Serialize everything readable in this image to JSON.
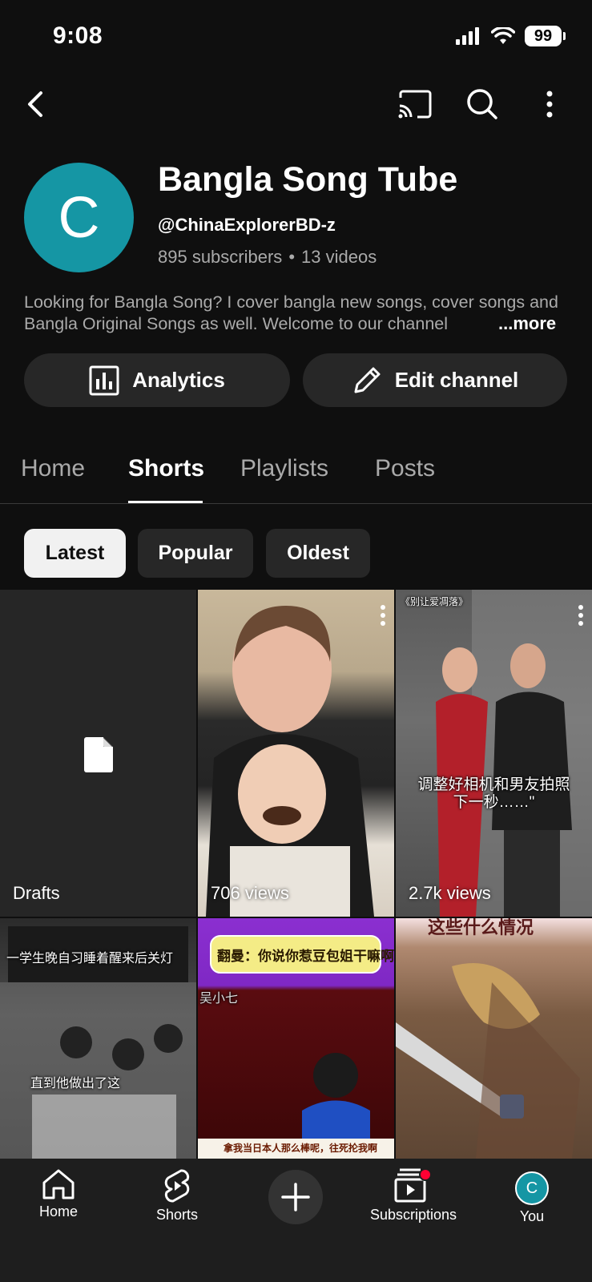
{
  "status_bar": {
    "time": "9:08",
    "battery": "99"
  },
  "channel": {
    "avatar_letter": "C",
    "name": "Bangla Song Tube",
    "handle": "@ChinaExplorerBD-z",
    "subscribers": "895 subscribers",
    "separator": "•",
    "videos": "13 videos",
    "description": "Looking for Bangla Song? I cover bangla new songs, cover songs and Bangla Original Songs as well. Welcome to our channel",
    "more_label": "...more"
  },
  "actions": {
    "analytics_label": "Analytics",
    "edit_label": "Edit channel"
  },
  "tabs": [
    {
      "label": "Home"
    },
    {
      "label": "Shorts"
    },
    {
      "label": "Playlists"
    },
    {
      "label": "Posts"
    }
  ],
  "chips": [
    {
      "label": "Latest"
    },
    {
      "label": "Popular"
    },
    {
      "label": "Oldest"
    }
  ],
  "grid": {
    "drafts_label": "Drafts",
    "items": [
      {
        "views": "706 views"
      },
      {
        "views": "2.7k views",
        "caption_top": "《别让爱凋落》",
        "caption_line1": "调整好相机和男友拍照",
        "caption_line2": "下一秒……\""
      },
      {
        "caption_top": "一学生晚自习睡着醒来后关灯",
        "caption_bottom": "直到他做出了这"
      },
      {
        "caption_top": "翻曼：你说你惹豆包姐干嘛啊",
        "caption_side": "吴小七",
        "caption_bottom": "拿我当日本人那么棒呢，往死抡我啊"
      },
      {
        "caption_top": "这些什么情况"
      }
    ]
  },
  "bottom_nav": [
    {
      "label": "Home"
    },
    {
      "label": "Shorts"
    },
    {
      "label": "Subscriptions"
    },
    {
      "label": "You",
      "avatar_letter": "C"
    }
  ],
  "colors": {
    "background": "#0f0f0f",
    "avatar": "#1596a4",
    "surface": "#272727",
    "notification": "#ff0033"
  }
}
